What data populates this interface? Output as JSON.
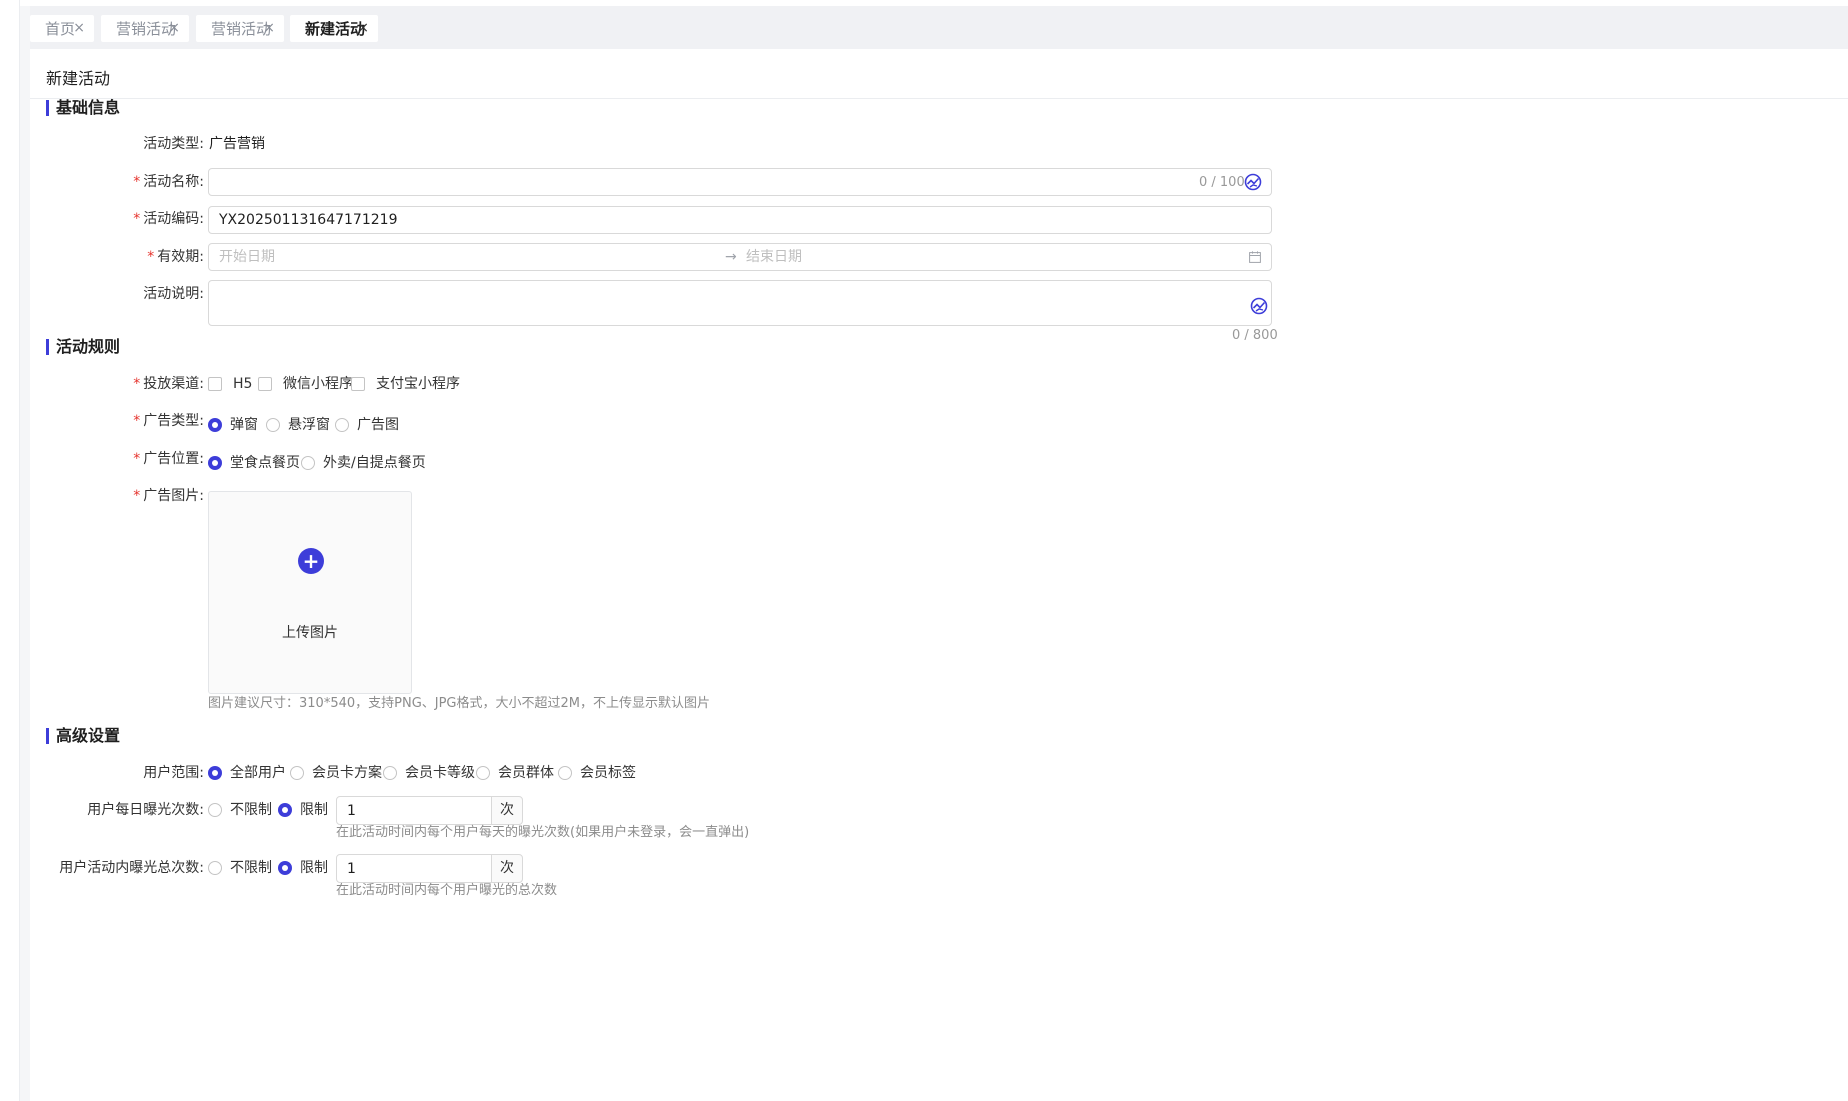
{
  "tabs": [
    {
      "label": "首页",
      "close": "×"
    },
    {
      "label": "营销活动",
      "close": "×"
    },
    {
      "label": "营销活动",
      "close": "×"
    },
    {
      "label": "新建活动",
      "close": "×",
      "active": true
    }
  ],
  "page_title": "新建活动",
  "sections": {
    "basic": "基础信息",
    "rules": "活动规则",
    "advanced": "高级设置"
  },
  "basic": {
    "type": {
      "label": "活动类型:",
      "value": "广告营销"
    },
    "name": {
      "label": "活动名称:",
      "value": "",
      "counter": "0 / 100"
    },
    "code": {
      "label": "活动编码:",
      "value": "YX202501131647171219"
    },
    "period": {
      "label": "有效期:",
      "start_placeholder": "开始日期",
      "arrow": "→",
      "end_placeholder": "结束日期"
    },
    "desc": {
      "label": "活动说明:",
      "value": "",
      "counter": "0 / 800"
    }
  },
  "rules": {
    "channel": {
      "label": "投放渠道:",
      "options": [
        "H5",
        "微信小程序",
        "支付宝小程序"
      ]
    },
    "ad_type": {
      "label": "广告类型:",
      "options": [
        "弹窗",
        "悬浮窗",
        "广告图"
      ],
      "selected": "弹窗"
    },
    "ad_position": {
      "label": "广告位置:",
      "options": [
        "堂食点餐页",
        "外卖/自提点餐页"
      ],
      "selected": "堂食点餐页"
    },
    "ad_image": {
      "label": "广告图片:",
      "upload_label": "上传图片",
      "hint": "图片建议尺寸：310*540，支持PNG、JPG格式，大小不超过2M，不上传显示默认图片"
    }
  },
  "advanced": {
    "user_scope": {
      "label": "用户范围:",
      "options": [
        "全部用户",
        "会员卡方案",
        "会员卡等级",
        "会员群体",
        "会员标签"
      ],
      "selected": "全部用户"
    },
    "daily": {
      "label": "用户每日曝光次数:",
      "options": [
        "不限制",
        "限制"
      ],
      "selected": "限制",
      "value": "1",
      "unit": "次",
      "hint": "在此活动时间内每个用户每天的曝光次数(如果用户未登录，会一直弹出)"
    },
    "total": {
      "label": "用户活动内曝光总次数:",
      "options": [
        "不限制",
        "限制"
      ],
      "selected": "限制",
      "value": "1",
      "unit": "次",
      "hint": "在此活动时间内每个用户曝光的总次数"
    }
  },
  "colors": {
    "accent": "#3d3dd9",
    "required": "#e5332d"
  }
}
